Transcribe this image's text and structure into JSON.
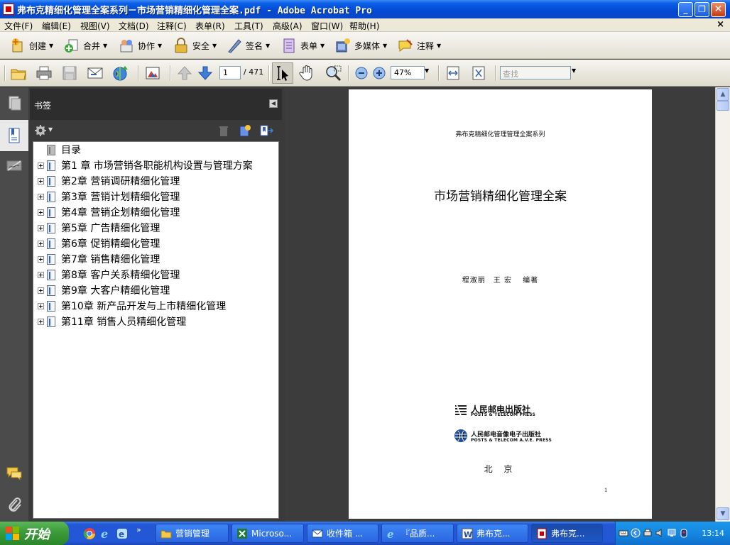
{
  "window": {
    "title": "弗布克精细化管理全案系列－市场营销精细化管理全案.pdf - Adobe Acrobat Pro",
    "minimize_label": "_",
    "maximize_label": "❐",
    "close_label": "✕"
  },
  "menu": {
    "items": [
      "文件(F)",
      "编辑(E)",
      "视图(V)",
      "文档(D)",
      "注释(C)",
      "表单(R)",
      "工具(T)",
      "高级(A)",
      "窗口(W)",
      "帮助(H)"
    ],
    "close_label": "×"
  },
  "tasks_toolbar": {
    "items": [
      {
        "label": "创建",
        "icon": "create-icon"
      },
      {
        "label": "合并",
        "icon": "combine-icon"
      },
      {
        "label": "协作",
        "icon": "collaborate-icon"
      },
      {
        "label": "安全",
        "icon": "lock-icon"
      },
      {
        "label": "签名",
        "icon": "pen-icon"
      },
      {
        "label": "表单",
        "icon": "form-icon"
      },
      {
        "label": "多媒体",
        "icon": "multimedia-icon"
      },
      {
        "label": "注释",
        "icon": "comment-icon"
      }
    ]
  },
  "standard_toolbar": {
    "page_current": "1",
    "page_total": "/ 471",
    "zoom": "47%",
    "find_placeholder": "查找"
  },
  "bookmarks": {
    "panel_title": "书签",
    "items": [
      {
        "label": "目录",
        "expandable": false
      },
      {
        "label": "第1 章 市场营销各职能机构设置与管理方案",
        "expandable": true
      },
      {
        "label": "第2章 营销调研精细化管理",
        "expandable": true
      },
      {
        "label": "第3章 营销计划精细化管理",
        "expandable": true
      },
      {
        "label": "第4章 营销企划精细化管理",
        "expandable": true
      },
      {
        "label": "第5章 广告精细化管理",
        "expandable": true
      },
      {
        "label": "第6章 促销精细化管理",
        "expandable": true
      },
      {
        "label": "第7章 销售精细化管理",
        "expandable": true
      },
      {
        "label": "第8章 客户关系精细化管理",
        "expandable": true
      },
      {
        "label": "第9章 大客户精细化管理",
        "expandable": true
      },
      {
        "label": "第10章 新产品开发与上市精细化管理",
        "expandable": true
      },
      {
        "label": "第11章 销售人员精细化管理",
        "expandable": true
      }
    ]
  },
  "document": {
    "series": "弗布克精细化管理管理全案系列",
    "title": "市场营销精细化管理全案",
    "authors": "程淑丽　王 宏　 编著",
    "publisher1_cn": "人民邮电出版社",
    "publisher1_en": "POSTS & TELECOM PRESS",
    "publisher2_cn": "人民邮电音像电子出版社",
    "publisher2_en": "POSTS & TELECOM A.V.E. PRESS",
    "city": "北 京",
    "page_number": "1"
  },
  "taskbar": {
    "start_label": "开始",
    "items": [
      {
        "label": "营销管理",
        "icon": "folder-icon"
      },
      {
        "label": "Microso...",
        "icon": "excel-icon"
      },
      {
        "label": "收件箱 ...",
        "icon": "outlook-icon"
      },
      {
        "label": "『品质...",
        "icon": "ie-icon"
      },
      {
        "label": "弗布克...",
        "icon": "word-icon"
      },
      {
        "label": "弗布克...",
        "icon": "acrobat-icon"
      }
    ],
    "clock": "13:14"
  }
}
